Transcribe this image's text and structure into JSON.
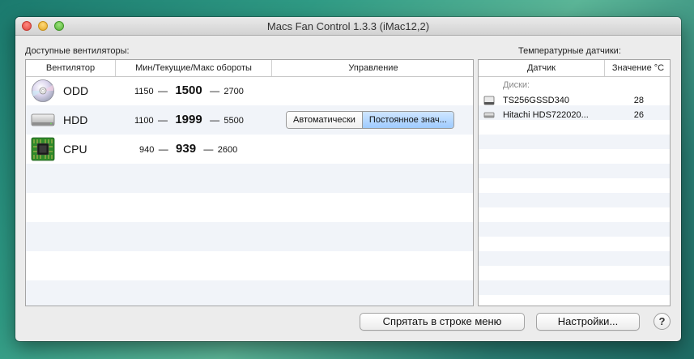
{
  "window": {
    "title": "Macs Fan Control 1.3.3 (iMac12,2)"
  },
  "fans_panel": {
    "label": "Доступные вентиляторы:",
    "columns": [
      "Вентилятор",
      "Мин/Текущие/Макс обороты",
      "Управление"
    ],
    "fans": [
      {
        "name": "ODD",
        "icon": "optical-disc-icon",
        "min": "1150",
        "current": "1500",
        "max": "2700",
        "dash": "—"
      },
      {
        "name": "HDD",
        "icon": "hard-drive-icon",
        "min": "1100",
        "current": "1999",
        "max": "5500",
        "dash": "—",
        "control": {
          "auto_label": "Автоматически",
          "constant_label": "Постоянное знач...",
          "selected": "constant"
        }
      },
      {
        "name": "CPU",
        "icon": "cpu-chip-icon",
        "min": "940",
        "current": "939",
        "max": "2600",
        "dash": "—"
      }
    ]
  },
  "sensors_panel": {
    "label": "Температурные датчики:",
    "columns": [
      "Датчик",
      "Значение °C"
    ],
    "group": "Диски:",
    "sensors": [
      {
        "name": "TS256GSSD340",
        "value": "28",
        "icon": "ssd-drive-icon"
      },
      {
        "name": "Hitachi HDS722020...",
        "value": "26",
        "icon": "hdd-drive-icon"
      }
    ]
  },
  "footer": {
    "hide_button": "Спрятать в строке меню",
    "settings_button": "Настройки...",
    "help_button": "?"
  },
  "colors": {
    "selected_segment": "#9ecbff",
    "row_stripe": "#f1f4f9"
  }
}
